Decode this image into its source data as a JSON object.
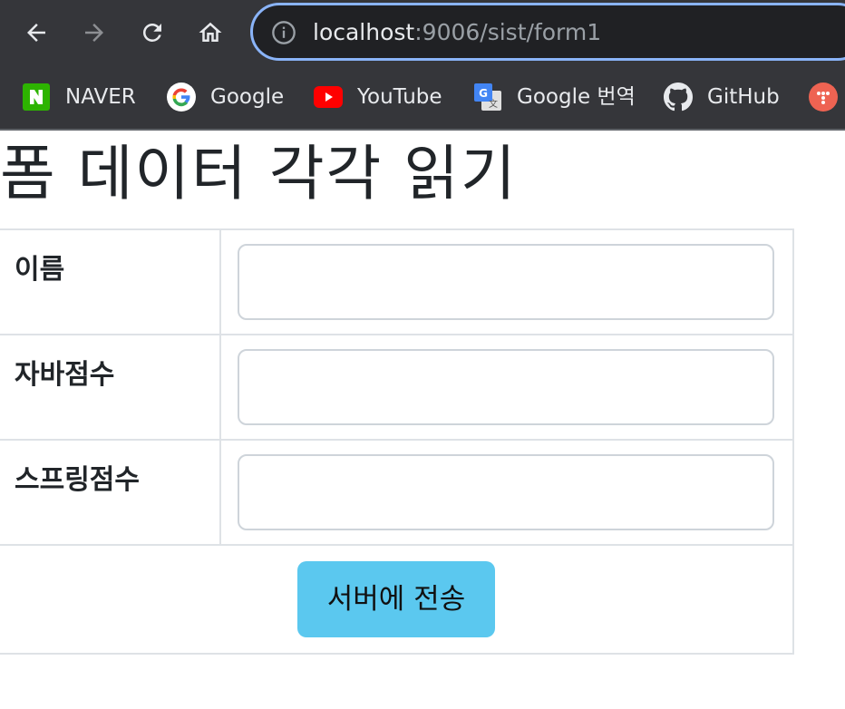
{
  "browser": {
    "url_host": "localhost",
    "url_path": ":9006/sist/form1",
    "nav_icons": [
      "back-arrow-icon",
      "forward-arrow-icon",
      "reload-icon",
      "home-icon"
    ],
    "omnibox_icon": "info-icon",
    "accent": "#8ab4f8",
    "bookmarks": [
      {
        "label": "NAVER",
        "icon": "naver-icon"
      },
      {
        "label": "Google",
        "icon": "google-icon"
      },
      {
        "label": "YouTube",
        "icon": "youtube-icon"
      },
      {
        "label": "Google 번역",
        "icon": "google-translate-icon"
      },
      {
        "label": "GitHub",
        "icon": "github-icon"
      }
    ]
  },
  "page": {
    "title": "폼 데이터 각각 읽기",
    "fields": [
      {
        "label": "이름",
        "value": "",
        "placeholder": ""
      },
      {
        "label": "자바점수",
        "value": "",
        "placeholder": ""
      },
      {
        "label": "스프링점수",
        "value": "",
        "placeholder": ""
      }
    ],
    "submit_label": "서버에 전송",
    "submit_color": "#5bc8ef"
  }
}
